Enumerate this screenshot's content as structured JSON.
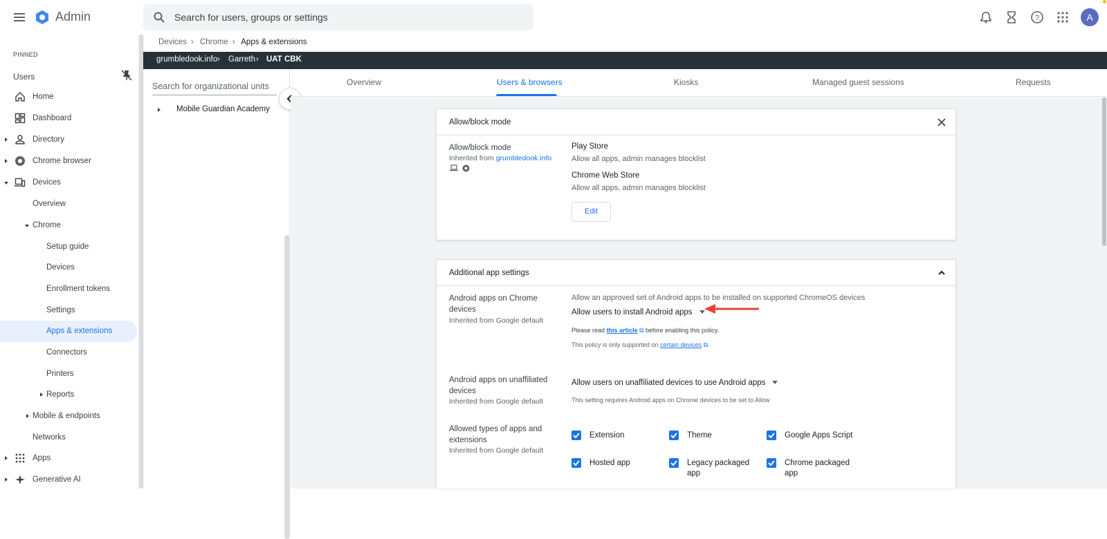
{
  "header": {
    "app_name": "Admin",
    "search_placeholder": "Search for users, groups or settings",
    "avatar_letter": "A"
  },
  "sidebar": {
    "pinned_label": "PINNED",
    "users_label": "Users",
    "items": [
      {
        "label": "Home"
      },
      {
        "label": "Dashboard"
      },
      {
        "label": "Directory"
      },
      {
        "label": "Chrome browser"
      },
      {
        "label": "Devices"
      },
      {
        "label": "Overview"
      },
      {
        "label": "Chrome"
      },
      {
        "label": "Setup guide"
      },
      {
        "label": "Devices"
      },
      {
        "label": "Enrollment tokens"
      },
      {
        "label": "Settings"
      },
      {
        "label": "Apps & extensions"
      },
      {
        "label": "Connectors"
      },
      {
        "label": "Printers"
      },
      {
        "label": "Reports"
      },
      {
        "label": "Mobile & endpoints"
      },
      {
        "label": "Networks"
      },
      {
        "label": "Apps"
      },
      {
        "label": "Generative AI"
      }
    ]
  },
  "breadcrumb": [
    "Devices",
    "Chrome",
    "Apps & extensions"
  ],
  "ou_path": [
    "grumbledook.info",
    "Garreth",
    "UAT CBK"
  ],
  "ou_panel": {
    "search_placeholder": "Search for organizational units",
    "root_item": "Mobile Guardian Academy"
  },
  "tabs": [
    "Overview",
    "Users & browsers",
    "Kiosks",
    "Managed guest sessions",
    "Requests"
  ],
  "allow_block_card": {
    "title": "Allow/block mode",
    "setting_label": "Allow/block mode",
    "inherited_prefix": "Inherited from",
    "inherited_link": "grumbledook.info",
    "play_store_title": "Play Store",
    "play_store_value": "Allow all apps, admin manages blocklist",
    "cws_title": "Chrome Web Store",
    "cws_value": "Allow all apps, admin manages blocklist",
    "edit_label": "Edit"
  },
  "additional_card": {
    "title": "Additional app settings",
    "android_label_1": "Android apps on Chrome",
    "android_label_2": "devices",
    "android_inherited": "Inherited from Google default",
    "android_desc": "Allow an approved set of Android apps to be installed on supported ChromeOS devices",
    "android_value": "Allow users to install Android apps",
    "note1_prefix": "Please read",
    "note1_link": "this article",
    "note1_suffix": "before enabling this policy.",
    "note2_prefix": "This policy is only supported on",
    "note2_link": "certain devices",
    "note2_suffix": ".",
    "unaff_label_1": "Android apps on unaffiliated",
    "unaff_label_2": "devices",
    "unaff_inherited": "Inherited from Google default",
    "unaff_value": "Allow users on unaffiliated devices to use Android apps",
    "unaff_note": "This setting requires Android apps on Chrome devices to be set to Allow",
    "types_label_1": "Allowed types of apps and",
    "types_label_2": "extensions",
    "types_inherited": "Inherited from Google default",
    "checkboxes": [
      {
        "label": "Extension",
        "checked": true
      },
      {
        "label": "Theme",
        "checked": true
      },
      {
        "label": "Google Apps Script",
        "checked": true
      },
      {
        "label": "Hosted app",
        "checked": true
      },
      {
        "label": "Legacy packaged",
        "label2": "app",
        "checked": true
      },
      {
        "label": "Chrome packaged",
        "label2": "app",
        "checked": true
      }
    ]
  },
  "colors": {
    "accent": "#1a73e8",
    "dark_bar": "#263238",
    "arrow": "#ea4335"
  }
}
